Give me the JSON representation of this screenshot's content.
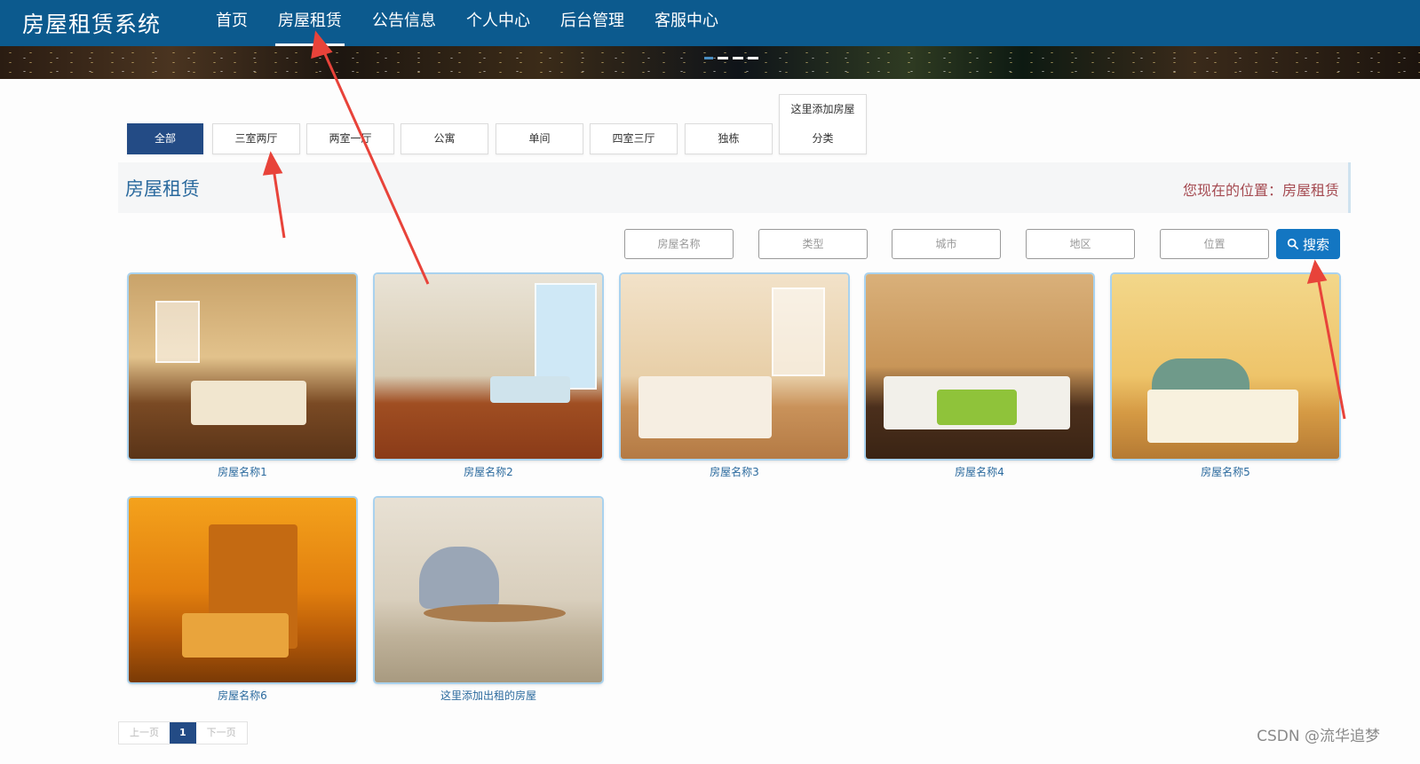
{
  "brand": "房屋租赁系统",
  "nav": [
    "首页",
    "房屋租赁",
    "公告信息",
    "个人中心",
    "后台管理",
    "客服中心"
  ],
  "categories": [
    "全部",
    "三室两厅",
    "两室一厅",
    "公寓",
    "单间",
    "四室三厅",
    "独栋"
  ],
  "add_category": {
    "line1": "这里添加房屋",
    "line2": "分类"
  },
  "section": {
    "title": "房屋租赁",
    "location": "您现在的位置：房屋租赁"
  },
  "search": {
    "fields": [
      "房屋名称",
      "类型",
      "城市",
      "地区",
      "位置"
    ],
    "button": "搜索"
  },
  "houses": [
    {
      "name": "房屋名称1"
    },
    {
      "name": "房屋名称2"
    },
    {
      "name": "房屋名称3"
    },
    {
      "name": "房屋名称4"
    },
    {
      "name": "房屋名称5"
    },
    {
      "name": "房屋名称6"
    },
    {
      "name": "这里添加出租的房屋"
    }
  ],
  "pagination": {
    "prev": "上一页",
    "current": "1",
    "next": "下一页"
  },
  "watermark": "CSDN @流华追梦",
  "colors": {
    "header": "#0c5a8e",
    "active_tab": "#234b85",
    "search_button": "#1376c2",
    "arrow": "#e8433a"
  }
}
